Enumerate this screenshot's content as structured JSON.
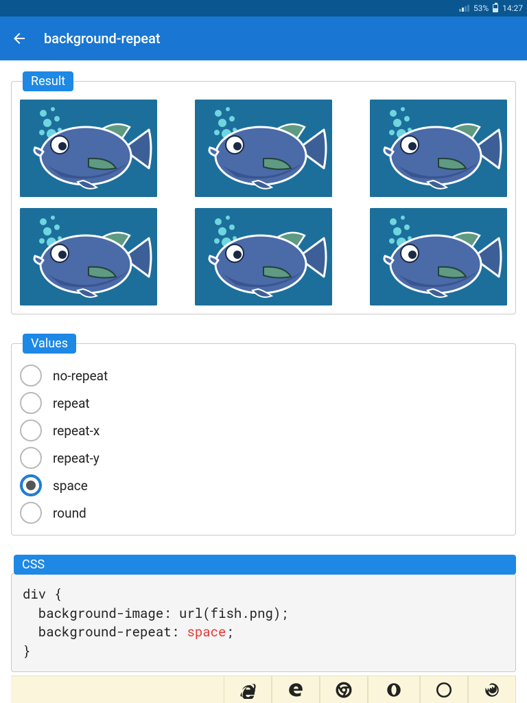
{
  "status": {
    "battery": "53%",
    "time": "14:27"
  },
  "appbar": {
    "title": "background-repeat"
  },
  "sections": {
    "result": "Result",
    "values": "Values",
    "css": "CSS"
  },
  "values": {
    "options": [
      "no-repeat",
      "repeat",
      "repeat-x",
      "repeat-y",
      "space",
      "round"
    ],
    "selected": "space"
  },
  "css": {
    "selector": "div {",
    "line1_prop": "background-image:",
    "line1_val": "url(fish.png);",
    "line2_prop": "background-repeat:",
    "line2_val": "space",
    "line2_tail": ";",
    "close": "}"
  },
  "browsers": [
    "ie",
    "edge",
    "chrome",
    "opera",
    "safari",
    "firefox"
  ]
}
